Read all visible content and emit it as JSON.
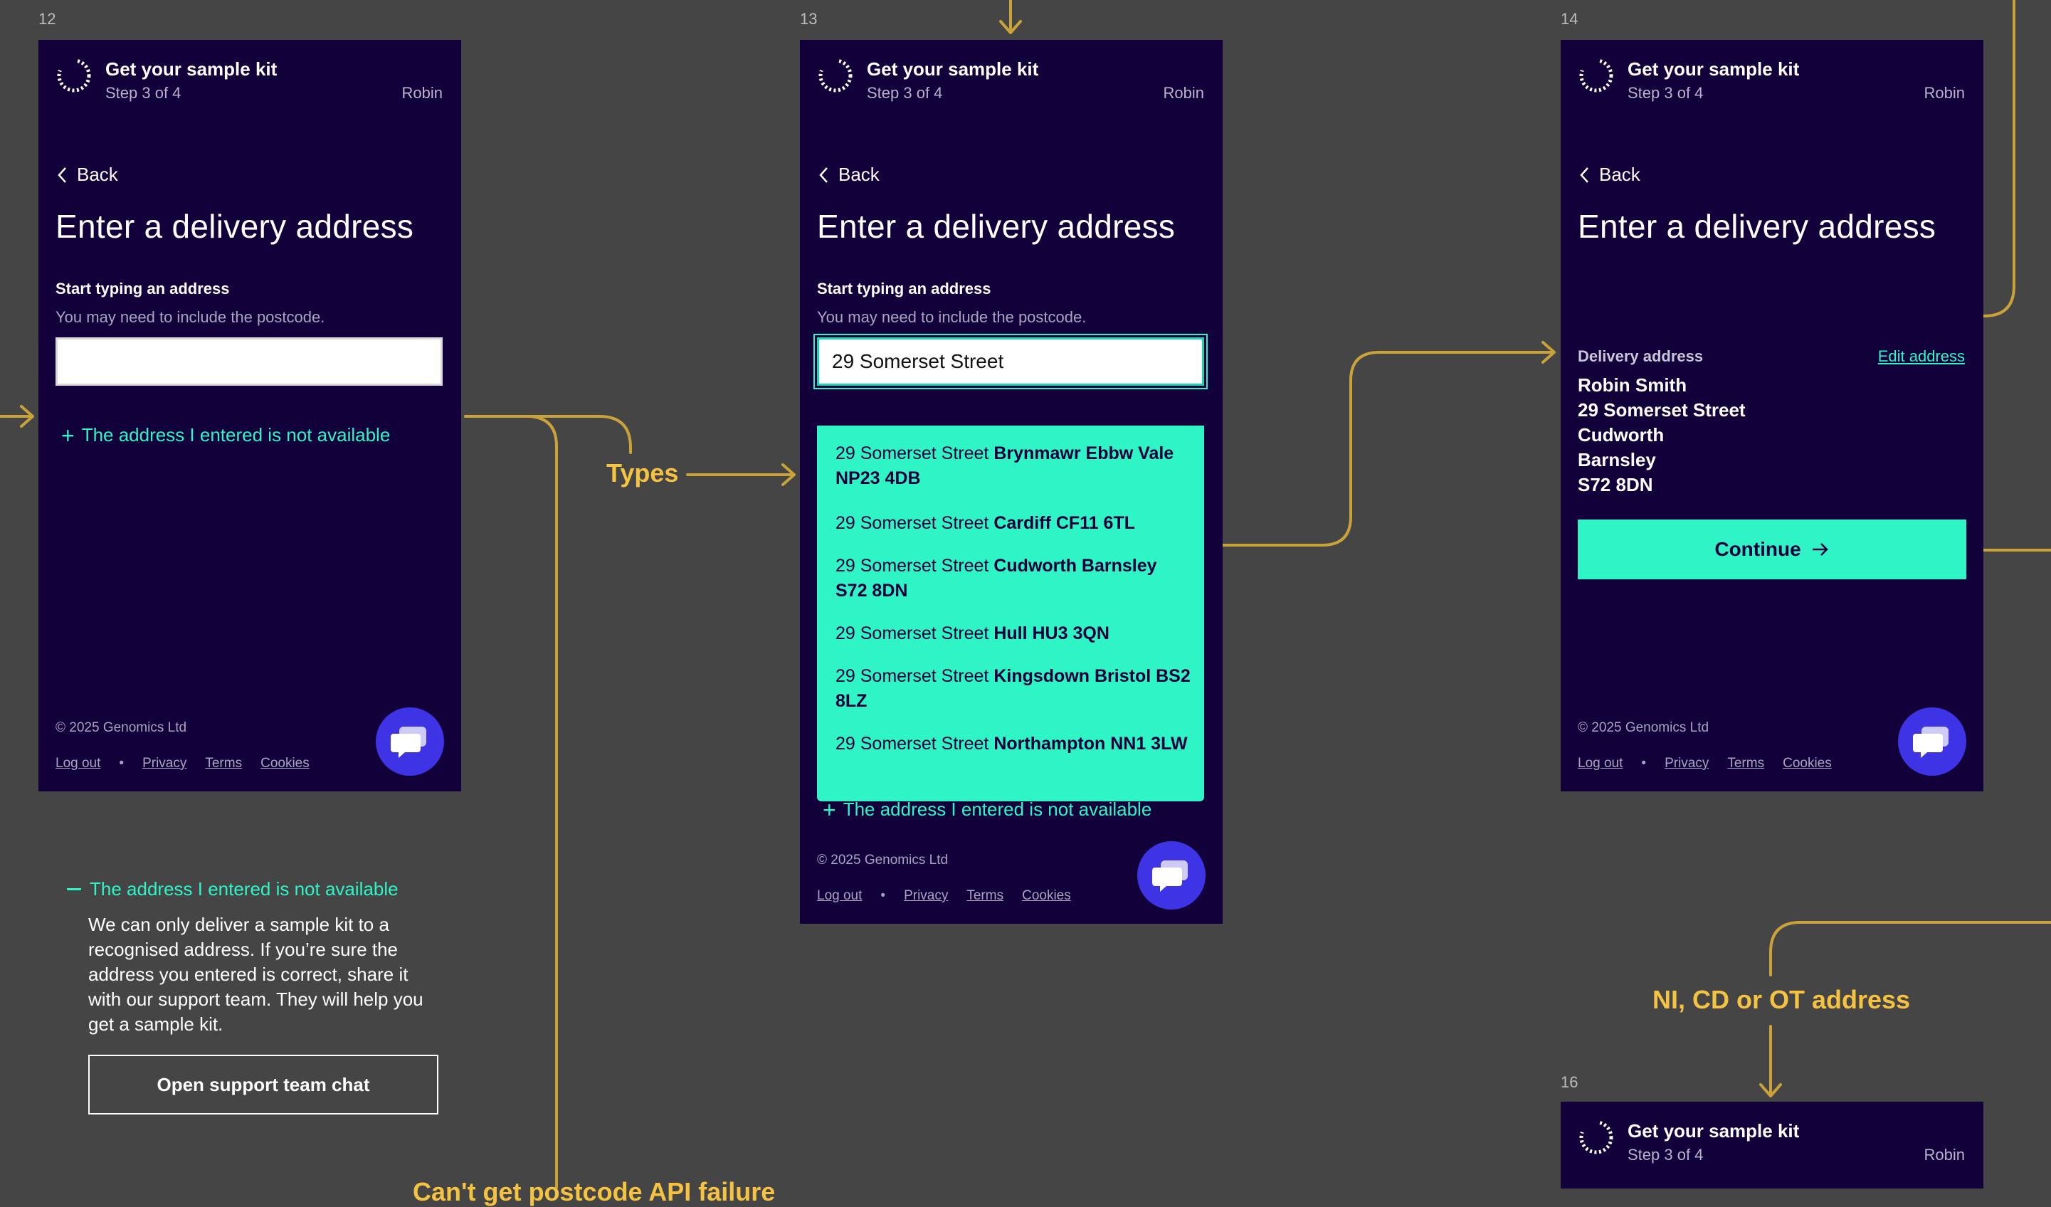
{
  "frames": {
    "f12": {
      "number": "12"
    },
    "f13": {
      "number": "13"
    },
    "f14": {
      "number": "14"
    },
    "f16": {
      "number": "16"
    }
  },
  "header": {
    "title": "Get your sample kit",
    "step": "Step 3 of 4",
    "user": "Robin"
  },
  "page": {
    "back_label": "Back",
    "title": "Enter a delivery address",
    "field_label": "Start typing an address",
    "field_hint": "You may need to include the postcode.",
    "not_available": "The address I entered is not available"
  },
  "search": {
    "value": "29 Somerset Street",
    "options": [
      {
        "street": "29 Somerset Street",
        "place": "Brynmawr Ebbw Vale NP23 4DB"
      },
      {
        "street": "29 Somerset Street",
        "place": "Cardiff CF11 6TL"
      },
      {
        "street": "29 Somerset Street",
        "place": "Cudworth Barnsley S72 8DN"
      },
      {
        "street": "29 Somerset Street",
        "place": "Hull HU3 3QN"
      },
      {
        "street": "29 Somerset Street",
        "place": "Kingsdown Bristol BS2 8LZ"
      },
      {
        "street": "29 Somerset Street",
        "place": "Northampton NN1 3LW"
      }
    ]
  },
  "confirm": {
    "delivery_label": "Delivery address",
    "edit_label": "Edit address",
    "address_lines": [
      "Robin Smith",
      "29 Somerset Street",
      "Cudworth",
      "Barnsley",
      "S72 8DN"
    ],
    "continue_label": "Continue"
  },
  "footer": {
    "copyright": "© 2025 Genomics Ltd",
    "logout": "Log out",
    "privacy": "Privacy",
    "terms": "Terms",
    "cookies": "Cookies"
  },
  "flow": {
    "types": "Types",
    "ni_cd_ot": "NI, CD or OT address",
    "api_fail": "Can't get postcode API failure"
  },
  "expanded_panel": {
    "toggle": "The address I entered is not available",
    "body": "We can only deliver a sample kit to a recognised address. If you’re sure the address you entered is correct, share it with our support team. They will help you get a sample kit.",
    "button": "Open support team chat"
  },
  "colors": {
    "canvas": "#454545",
    "screen_bg": "#12003a",
    "accent": "#2ff4c6",
    "flow": "#f5c242",
    "chat": "#3f33e6"
  },
  "icons": [
    "spinner-logo-icon",
    "chevron-left-icon",
    "plus-icon",
    "minus-icon",
    "chat-bubbles-icon",
    "arrow-right-icon"
  ]
}
